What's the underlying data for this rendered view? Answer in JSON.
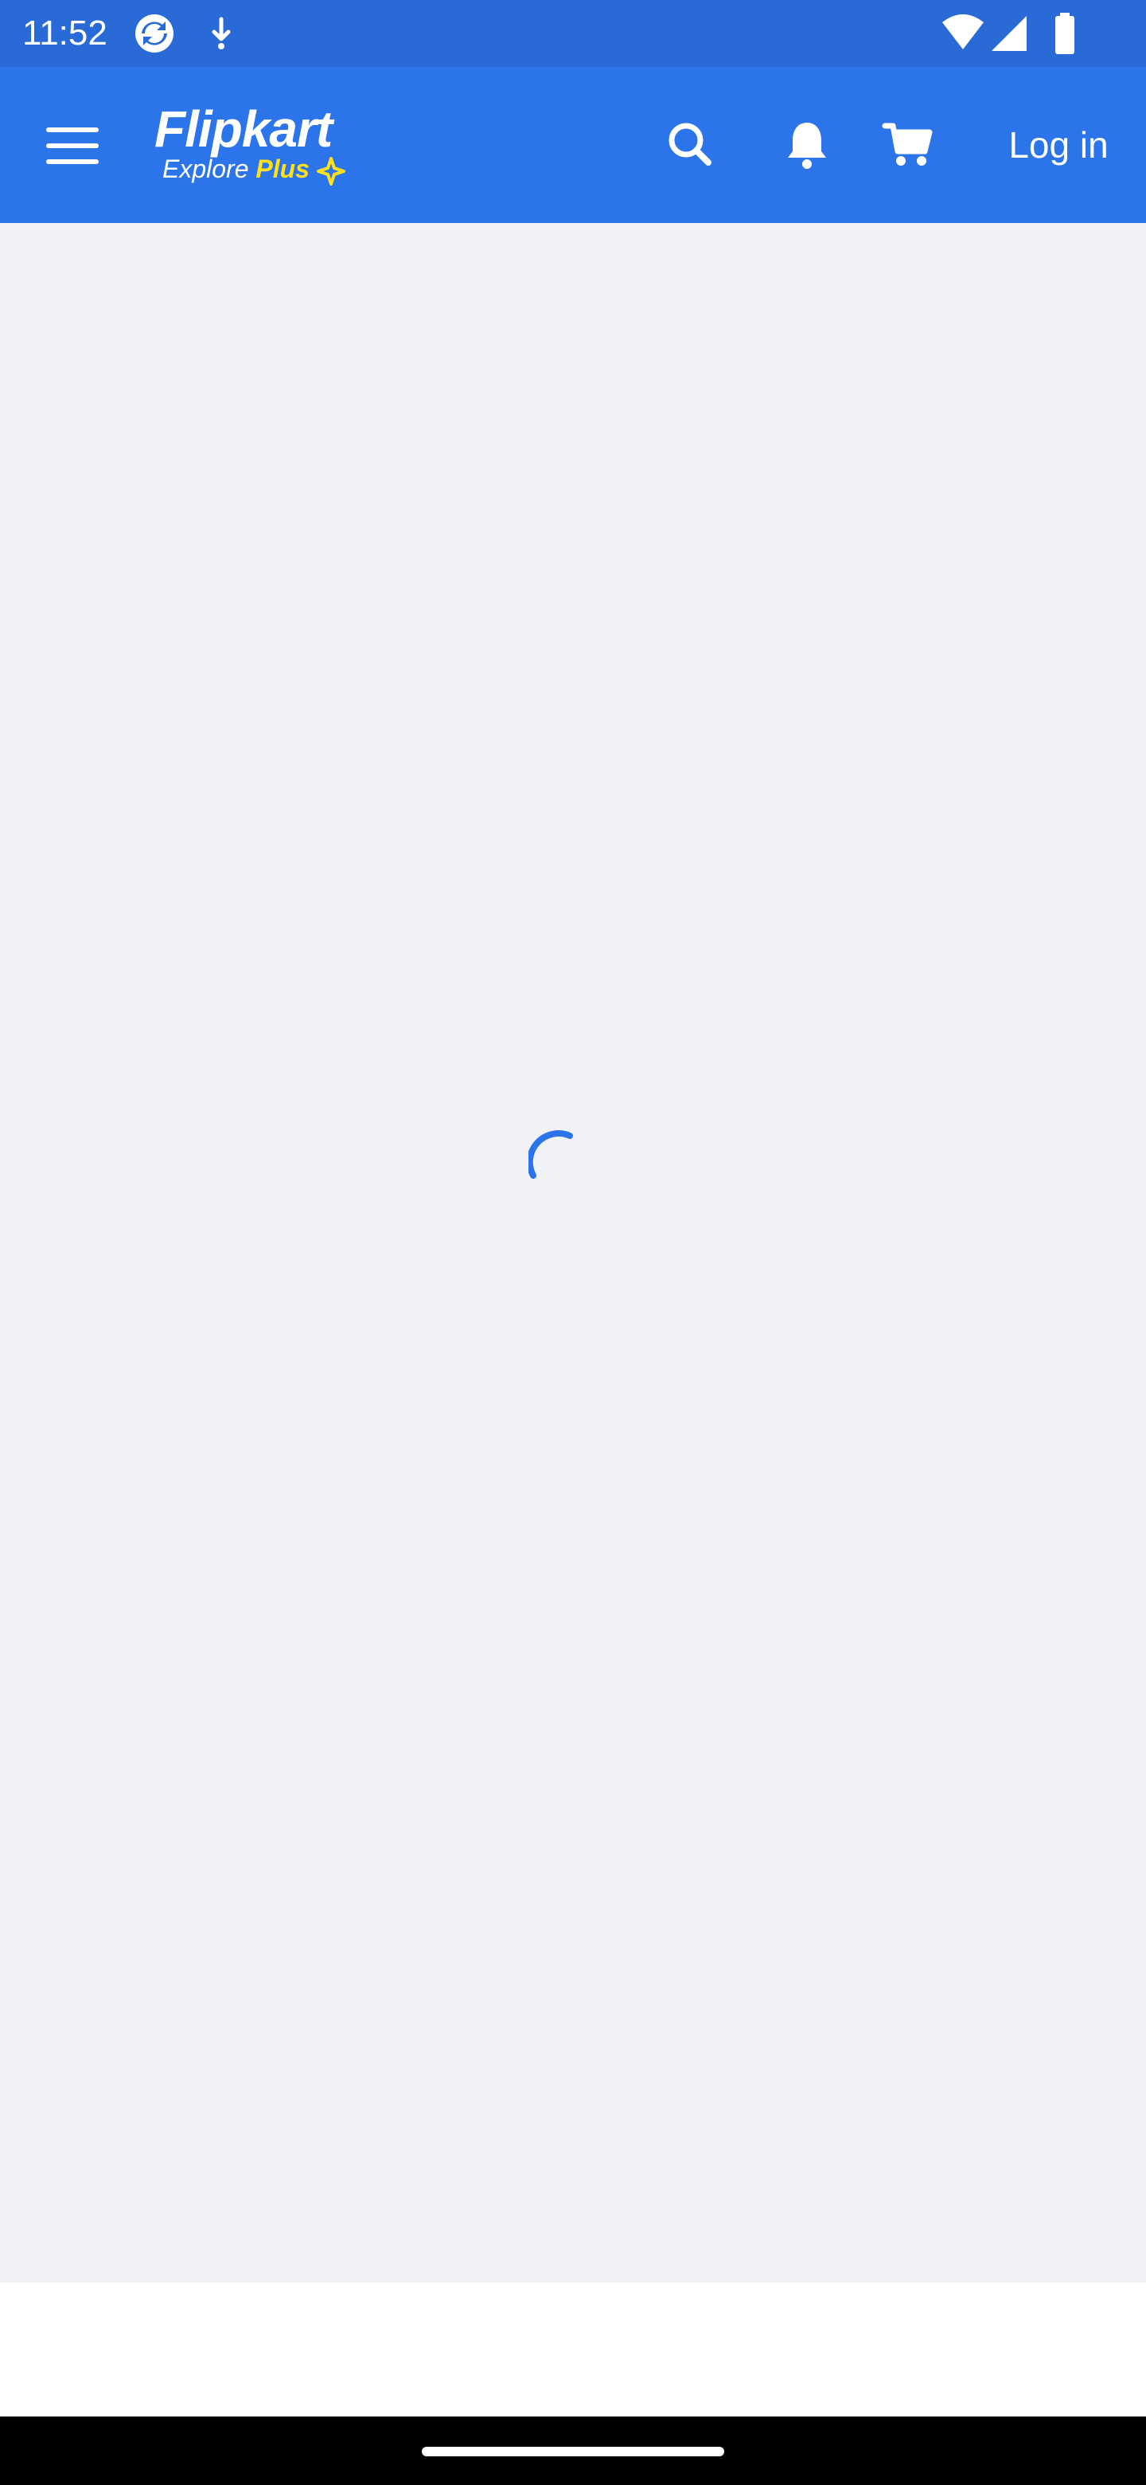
{
  "status_bar": {
    "time": "11:52",
    "icons": [
      "sync-app-icon",
      "download-notification-icon",
      "wifi-icon",
      "signal-icon",
      "battery-icon"
    ]
  },
  "header": {
    "menu_icon": "hamburger-menu-icon",
    "logo": {
      "name": "Flipkart",
      "sub_explore": "Explore",
      "sub_plus": "Plus"
    },
    "icons": [
      "search-icon",
      "bell-icon",
      "cart-icon"
    ],
    "login_label": "Log in"
  },
  "colors": {
    "status_bar_bg": "#2a6ad6",
    "header_bg": "#2b74ea",
    "page_bg": "#f0f2f5",
    "plus_yellow": "#ffe11b",
    "spinner": "#2b74ea",
    "nav_bar_bg": "#000000"
  },
  "main": {
    "state": "loading",
    "spinner_icon": "loading-spinner-icon"
  }
}
